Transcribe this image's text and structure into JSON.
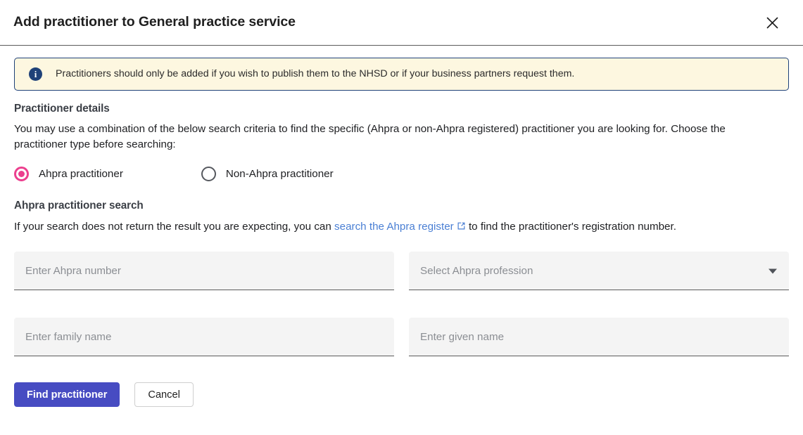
{
  "header": {
    "title": "Add practitioner to General practice service",
    "close_icon": "close-icon"
  },
  "banner": {
    "icon": "info-icon",
    "text": "Practitioners should only be added if you wish to publish them to the NHSD or if your business partners request them.",
    "background_color": "#fdf7e0",
    "border_color": "#1f4178"
  },
  "practitioner_details": {
    "heading": "Practitioner details",
    "description": "You may use a combination of the below search criteria to find the specific (Ahpra or non-Ahpra registered) practitioner you are looking for. Choose the practitioner type before searching:",
    "radios": [
      {
        "label": "Ahpra practitioner",
        "selected": true,
        "accent_color": "#ec3f8e"
      },
      {
        "label": "Non-Ahpra practitioner",
        "selected": false
      }
    ]
  },
  "ahpra_search": {
    "heading": "Ahpra practitioner search",
    "hint_before": "If your search does not return the result you are expecting, you can ",
    "link_text": "search the Ahpra register",
    "link_icon": "external-link-icon",
    "link_color": "#4a7fd4",
    "hint_after": " to find the practitioner's registration number.",
    "fields": {
      "ahpra_number": {
        "value": "",
        "placeholder": "Enter Ahpra number"
      },
      "ahpra_profession": {
        "value": "Select Ahpra profession",
        "icon": "chevron-down-icon"
      },
      "family_name": {
        "value": "",
        "placeholder": "Enter family name"
      },
      "given_name": {
        "value": "",
        "placeholder": "Enter given name"
      }
    }
  },
  "actions": {
    "primary_label": "Find practitioner",
    "primary_color": "#474cc2",
    "secondary_label": "Cancel"
  }
}
